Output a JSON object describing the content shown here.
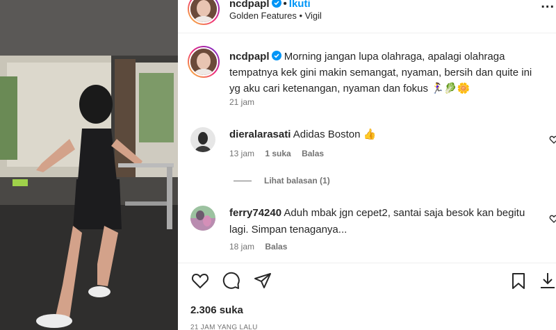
{
  "header": {
    "username": "ncdpapl",
    "follow_label": "Ikuti",
    "separator": "•",
    "audio": "Golden Features • Vigil",
    "more": "..."
  },
  "caption": {
    "username": "ncdpapl",
    "text": "Morning jangan lupa olahraga, apalagi olahraga tempatnya kek gini makin semangat, nyaman, bersih dan quite ini yg aku cari ketenangan, nyaman dan fokus 🏃‍♀️🥬🌼",
    "time": "21 jam"
  },
  "comments": [
    {
      "username": "dieralarasati",
      "text": "Adidas Boston 👍",
      "time": "13 jam",
      "likes": "1 suka",
      "reply": "Balas"
    },
    {
      "username": "ferry74240",
      "text": "Aduh mbak jgn cepet2, santai saja besok kan begitu lagi. Simpan tenaganya...",
      "time": "18 jam",
      "reply": "Balas"
    }
  ],
  "view_replies": "Lihat balasan (1)",
  "likes": "2.306 suka",
  "date": "21 JAM YANG LALU",
  "colors": {
    "accent": "#0095f6",
    "text": "#262626",
    "muted": "#737373"
  },
  "icons": [
    "verified-icon",
    "more-icon",
    "heart-icon",
    "comment-icon",
    "share-icon",
    "bookmark-icon",
    "download-icon"
  ]
}
